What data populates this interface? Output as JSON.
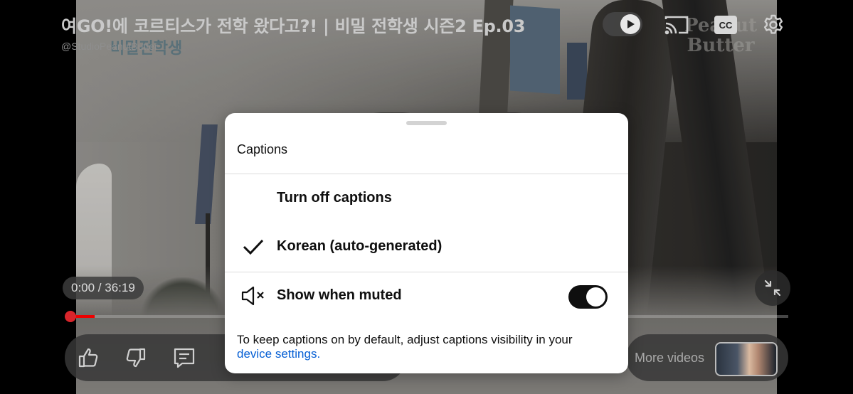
{
  "video": {
    "title": "여GO!에 코르티스가 전학 왔다고?! | 비밀 전학생 시즌2 Ep.03",
    "channel": "@StudioPeanutButter",
    "watermark_line1": "Peanut",
    "watermark_line2": "Butter",
    "sign_text": "비밀전학생"
  },
  "top_controls": {
    "autoplay_icon": "play-icon",
    "cast_icon": "cast-icon",
    "cc_label": "CC",
    "settings_icon": "gear-icon"
  },
  "player": {
    "current_time": "0:00",
    "separator": "/",
    "duration": "36:19",
    "time_text": "0:00 / 36:19",
    "progress_fraction": 0.04,
    "more_videos_label": "More videos"
  },
  "captions_sheet": {
    "heading": "Captions",
    "options": [
      {
        "label": "Turn off captions",
        "selected": false
      },
      {
        "label": "Korean (auto-generated)",
        "selected": true
      }
    ],
    "show_when_muted_label": "Show when muted",
    "show_when_muted_on": true,
    "note_text": "To keep captions on by default, adjust captions visibility in your",
    "note_link": "device settings."
  },
  "colors": {
    "accent_red": "#d8252b",
    "link_blue": "#065fd4",
    "toggle_on": "#0f0f0f"
  }
}
